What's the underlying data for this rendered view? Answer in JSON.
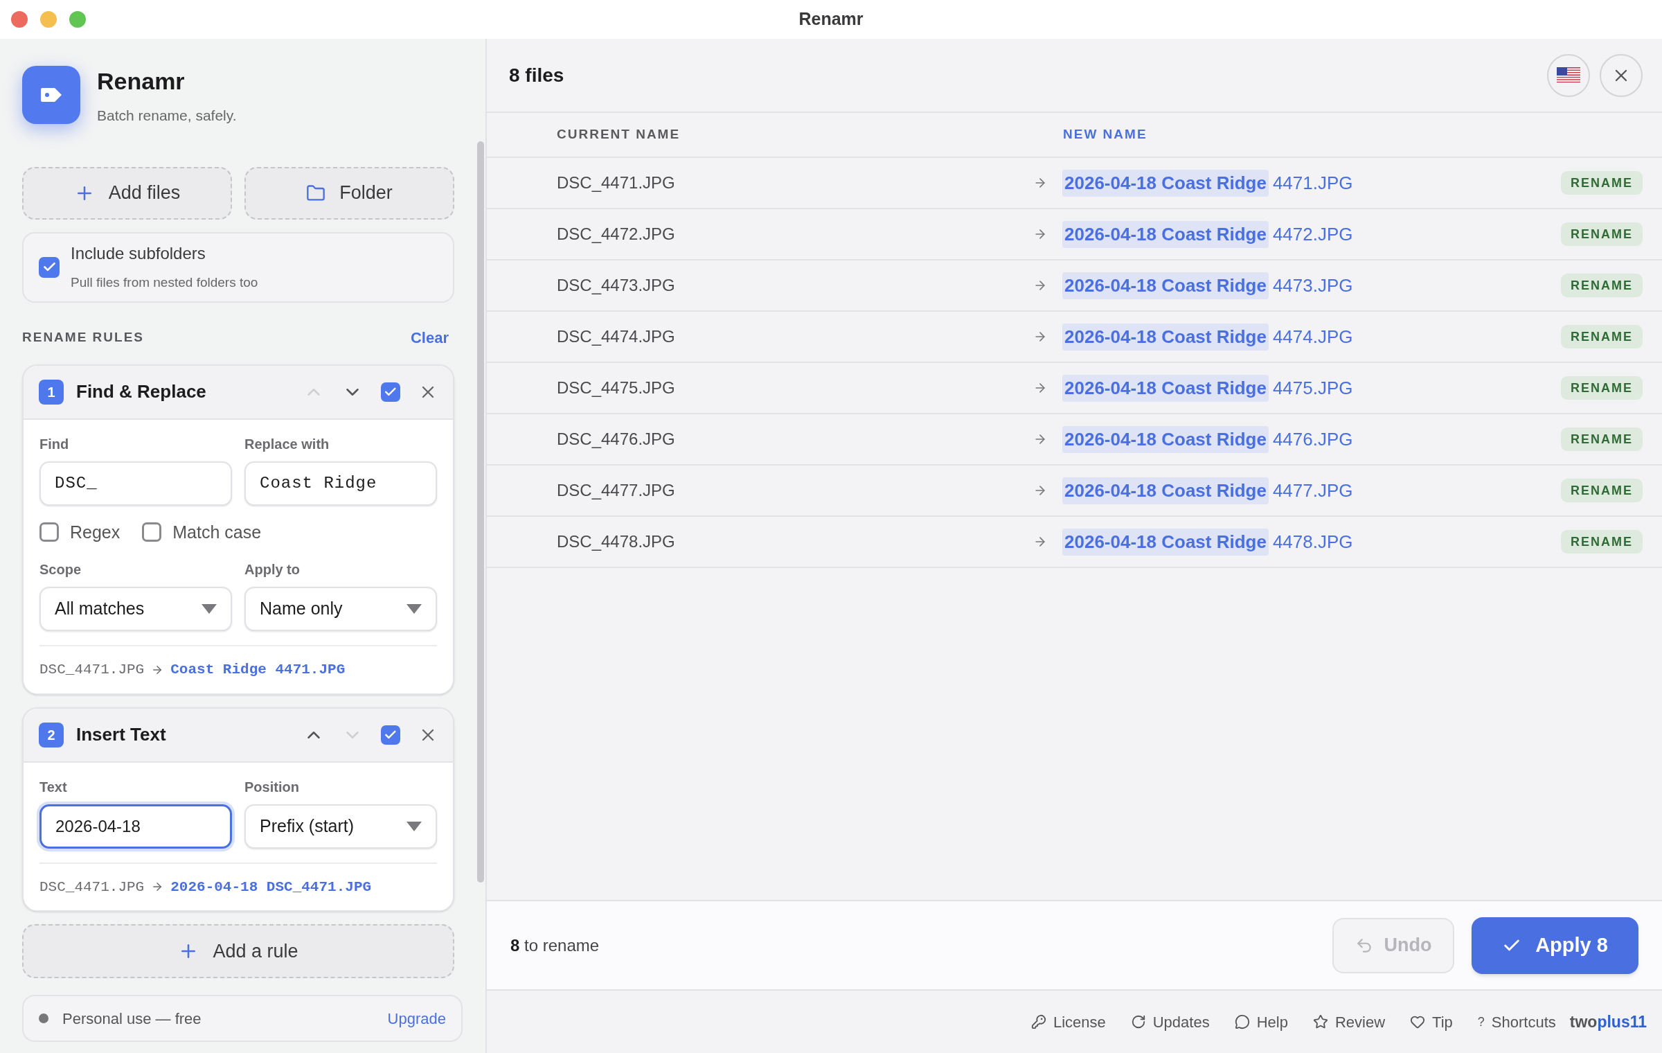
{
  "window": {
    "title": "Renamr"
  },
  "sidebar": {
    "app": {
      "name": "Renamr",
      "tagline": "Batch rename, safely."
    },
    "source_buttons": [
      "Add files",
      "Folder"
    ],
    "include_subfolders": {
      "label": "Include subfolders",
      "hint": "Pull files from nested folders too",
      "checked": true
    },
    "rules_heading": "RENAME RULES",
    "clear_link": "Clear",
    "rules": [
      {
        "number": "1",
        "title": "Find & Replace",
        "can_move_up": false,
        "can_move_down": true,
        "enabled": true,
        "rows": [
          {
            "kind": "fields",
            "fields": [
              {
                "kind": "text",
                "label": "Find",
                "value": "DSC_",
                "mono": true,
                "focused": false
              },
              {
                "kind": "text",
                "label": "Replace with",
                "value": "Coast Ridge",
                "mono": true,
                "focused": false
              }
            ]
          },
          {
            "kind": "checkboxes",
            "items": [
              {
                "label": "Regex",
                "checked": false
              },
              {
                "label": "Match case",
                "checked": false
              }
            ]
          },
          {
            "kind": "fields",
            "fields": [
              {
                "kind": "select",
                "label": "Scope",
                "value": "All matches"
              },
              {
                "kind": "select",
                "label": "Apply to",
                "value": "Name only"
              }
            ]
          }
        ],
        "preview": {
          "before": "DSC_4471.JPG",
          "after": "Coast Ridge 4471.JPG"
        }
      },
      {
        "number": "2",
        "title": "Insert Text",
        "can_move_up": true,
        "can_move_down": false,
        "enabled": true,
        "rows": [
          {
            "kind": "fields",
            "fields": [
              {
                "kind": "text",
                "label": "Text",
                "value": "2026-04-18",
                "mono": false,
                "focused": true
              },
              {
                "kind": "select",
                "label": "Position",
                "value": "Prefix (start)"
              }
            ]
          }
        ],
        "preview": {
          "before": "DSC_4471.JPG",
          "after": "2026-04-18 DSC_4471.JPG"
        }
      }
    ],
    "add_rule": "Add a rule",
    "license": {
      "text": "Personal use — free",
      "link": "Upgrade"
    }
  },
  "main": {
    "title": "8 files",
    "columns": [
      "CURRENT NAME",
      "NEW NAME"
    ],
    "rows": [
      {
        "current": "DSC_4471.JPG",
        "changed": "2026-04-18 Coast Ridge",
        "rest": "4471.JPG",
        "status": "RENAME"
      },
      {
        "current": "DSC_4472.JPG",
        "changed": "2026-04-18 Coast Ridge",
        "rest": "4472.JPG",
        "status": "RENAME"
      },
      {
        "current": "DSC_4473.JPG",
        "changed": "2026-04-18 Coast Ridge",
        "rest": "4473.JPG",
        "status": "RENAME"
      },
      {
        "current": "DSC_4474.JPG",
        "changed": "2026-04-18 Coast Ridge",
        "rest": "4474.JPG",
        "status": "RENAME"
      },
      {
        "current": "DSC_4475.JPG",
        "changed": "2026-04-18 Coast Ridge",
        "rest": "4475.JPG",
        "status": "RENAME"
      },
      {
        "current": "DSC_4476.JPG",
        "changed": "2026-04-18 Coast Ridge",
        "rest": "4476.JPG",
        "status": "RENAME"
      },
      {
        "current": "DSC_4477.JPG",
        "changed": "2026-04-18 Coast Ridge",
        "rest": "4477.JPG",
        "status": "RENAME"
      },
      {
        "current": "DSC_4478.JPG",
        "changed": "2026-04-18 Coast Ridge",
        "rest": "4478.JPG",
        "status": "RENAME"
      }
    ],
    "summary": {
      "count": "8",
      "text": "to rename"
    },
    "undo": {
      "label": "Undo",
      "disabled": true
    },
    "apply": "Apply 8",
    "footer_links": [
      {
        "label": "License"
      },
      {
        "label": "Updates"
      },
      {
        "label": "Help"
      },
      {
        "label": "Review"
      },
      {
        "label": "Tip"
      },
      {
        "label": "Shortcuts",
        "glyph": "?"
      }
    ],
    "brand": {
      "part_1": "two",
      "part_2": "plus11"
    }
  }
}
